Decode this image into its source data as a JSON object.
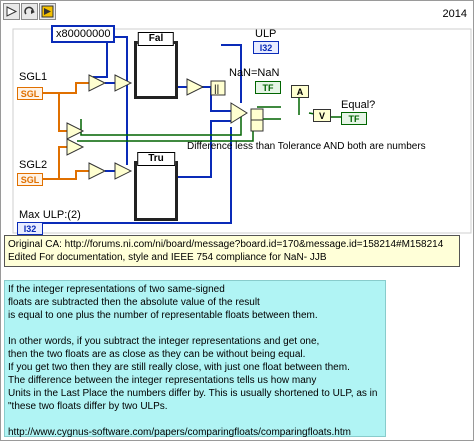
{
  "header": {
    "toolbar": [
      {
        "name": "run-arrow-icon"
      },
      {
        "name": "run-continuously-icon"
      },
      {
        "name": "abort-icon"
      }
    ],
    "year": "2014"
  },
  "diagram": {
    "hex_constant": "x80000000",
    "case_false_label": "Fal",
    "case_true_label": "Tru",
    "ulp_label": "ULP",
    "ulp_type": "I32",
    "sgl1_label": "SGL1",
    "sgl2_label": "SGL2",
    "sgl_type": "SGL",
    "nan_label": "NaN=NaN",
    "tf_type": "TF",
    "equal_label": "Equal?",
    "and_text": "A",
    "or_text": "V",
    "max_ulp_label": "Max ULP:(2)",
    "tolerance_comment": "Difference less than Tolerance AND both are numbers"
  },
  "notes": {
    "line1": "Original CA: http://forums.ni.com/ni/board/message?board.id=170&message.id=158214#M158214",
    "line2": "Edited For documentation, style and IEEE 754 compliance for NaN- JJB"
  },
  "description": {
    "lines": [
      "If the integer representations of two same-signed",
      "floats are subtracted then the absolute value of the result",
      "is equal to one plus the number of representable floats between them.",
      "",
      "In other words, if you subtract the integer representations and get one,",
      "then the two floats are as close as they can be without being equal.",
      "If you get two then they are still really close, with just one float between them.",
      "The difference between the integer representations tells us how many",
      "Units in the Last Place the numbers differ by. This is usually shortened to ULP, as in",
      "\"these two floats differ by two ULPs.",
      "",
      "http://www.cygnus-software.com/papers/comparingfloats/comparingfloats.htm"
    ]
  },
  "colors": {
    "wire_sgl": "#e07000",
    "wire_i32": "#0a2bb8",
    "wire_bool": "#006400",
    "notes_bg": "#ffffd8",
    "description_bg": "#b0f4f4"
  }
}
